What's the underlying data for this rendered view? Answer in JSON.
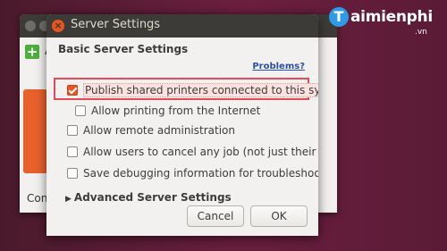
{
  "background_window": {
    "action_initial": "A",
    "status_label": "Conn"
  },
  "watermark": {
    "logo_letter": "T",
    "text": "aimienphi",
    "suffix": ".vn"
  },
  "dialog": {
    "title": "Server Settings",
    "heading": "Basic Server Settings",
    "problems_link": "Problems?",
    "options": [
      {
        "label": "Publish shared printers connected to this system",
        "checked": true
      },
      {
        "label": "Allow printing from the Internet",
        "checked": false
      },
      {
        "label": "Allow remote administration",
        "checked": false
      },
      {
        "label": "Allow users to cancel any job (not just their own)",
        "checked": false
      },
      {
        "label": "Save debugging information for troubleshooting",
        "checked": false
      }
    ],
    "advanced_label": "Advanced Server Settings",
    "cancel_label": "Cancel",
    "ok_label": "OK"
  },
  "colors": {
    "accent": "#e95420",
    "highlight_border": "#e24c5a",
    "titlebar": "#3c3b37"
  }
}
